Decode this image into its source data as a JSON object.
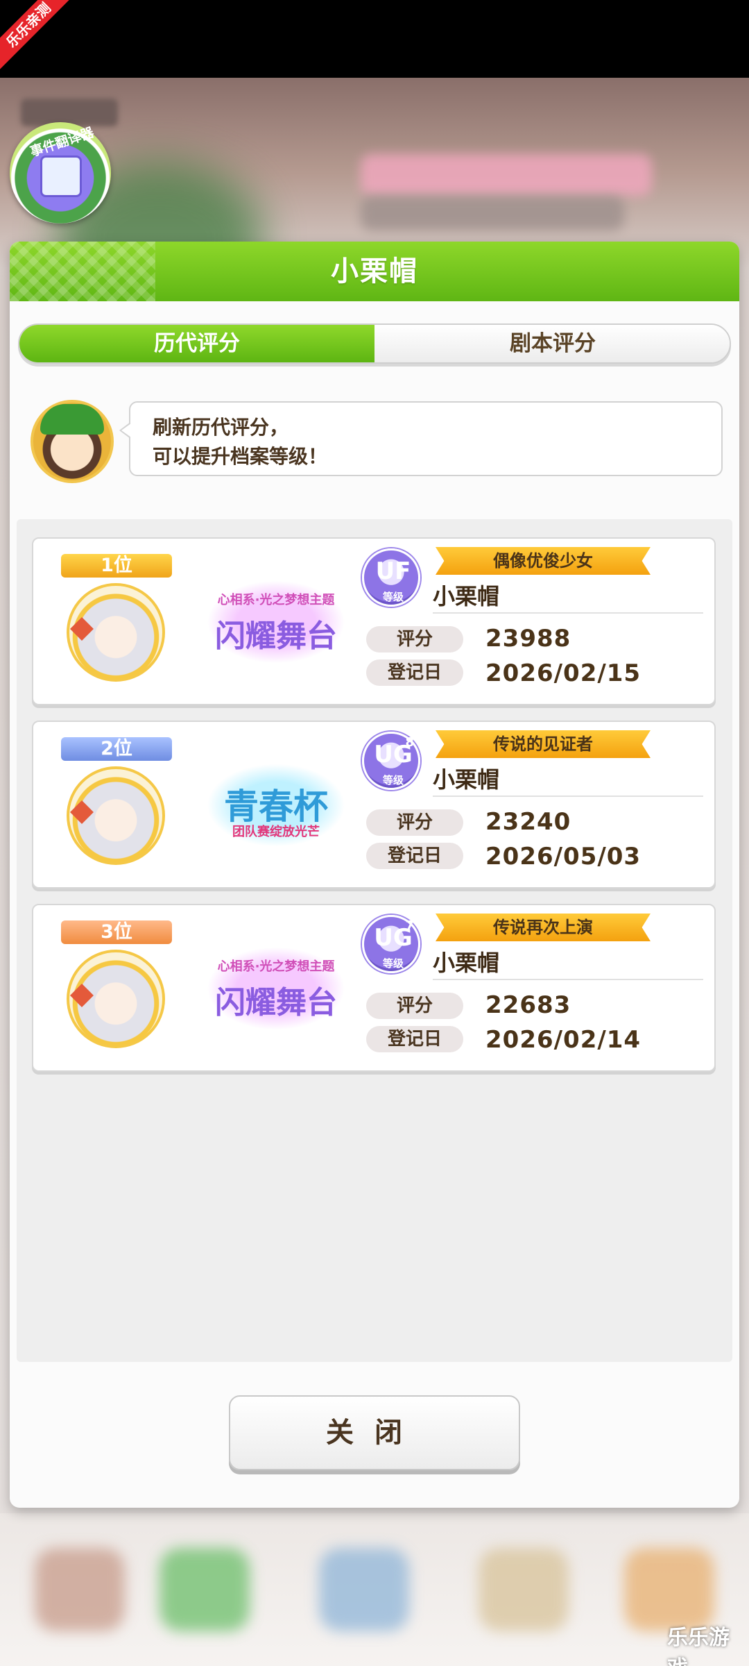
{
  "corner_label": "乐乐亲测",
  "translator_badge": {
    "label": "事件翻译器"
  },
  "dialog": {
    "title": "小栗帽",
    "tabs": [
      {
        "label": "历代评分",
        "active": true
      },
      {
        "label": "剧本评分",
        "active": false
      }
    ],
    "advisor_message": {
      "line1": "刷新历代评分，",
      "line2": "可以提升档案等级！"
    },
    "records": [
      {
        "rank": "1位",
        "event": "闪耀舞台",
        "event_sub": "心相系·光之梦想主题",
        "grade_letters": "UF",
        "grade_sup": "",
        "grade_sub": "等级",
        "title": "偶像优俊少女",
        "name": "小栗帽",
        "score_label": "评分",
        "score": "23988",
        "date_label": "登记日",
        "date": "2026/02/15"
      },
      {
        "rank": "2位",
        "event": "青春杯",
        "event_sub": "团队赛绽放光芒",
        "grade_letters": "UG",
        "grade_sup": "8",
        "grade_sub": "等级",
        "title": "传说的见证者",
        "name": "小栗帽",
        "score_label": "评分",
        "score": "23240",
        "date_label": "登记日",
        "date": "2026/05/03"
      },
      {
        "rank": "3位",
        "event": "闪耀舞台",
        "event_sub": "心相系·光之梦想主题",
        "grade_letters": "UG",
        "grade_sup": "7",
        "grade_sub": "等级",
        "title": "传说再次上演",
        "name": "小栗帽",
        "score_label": "评分",
        "score": "22683",
        "date_label": "登记日",
        "date": "2026/02/14"
      }
    ],
    "close_label": "关闭"
  },
  "watermark": "乐乐游戏",
  "colors": {
    "header_green": "#5fb614",
    "banner_gold": "#f4a10f",
    "text_brown": "#4a3318",
    "badge_purple": "#8d74e6"
  }
}
